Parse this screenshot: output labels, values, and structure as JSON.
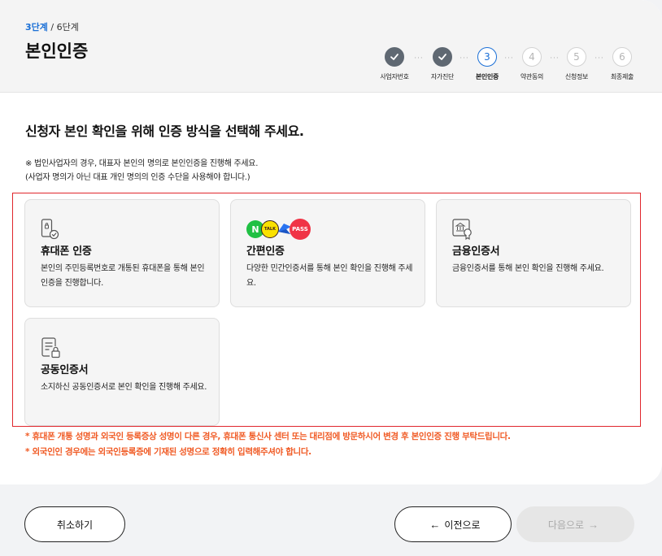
{
  "progress": {
    "current": "3단계",
    "separator": " / ",
    "total": "6단계"
  },
  "page_title": "본인인증",
  "steps": [
    {
      "label": "사업자번호",
      "state": "done"
    },
    {
      "label": "자가진단",
      "state": "done"
    },
    {
      "number": "3",
      "label": "본인인증",
      "state": "active"
    },
    {
      "number": "4",
      "label": "약관동의",
      "state": "todo"
    },
    {
      "number": "5",
      "label": "신청정보",
      "state": "todo"
    },
    {
      "number": "6",
      "label": "최종제출",
      "state": "todo"
    }
  ],
  "step_separator": "···",
  "heading": "신청자 본인 확인을 위해 인증 방식을 선택해 주세요.",
  "notes": {
    "line1": "※ 법인사업자의 경우, 대표자 본인의 명의로 본인인증을 진행해 주세요.",
    "line2": "(사업자 명의가 아닌 대표 개인 명의의 인증 수단을 사용해야 합니다.)"
  },
  "options": {
    "phone": {
      "title": "휴대폰 인증",
      "desc": "본인의 주민등록번호로 개통된 휴대폰을 통해 본인 인증을 진행합니다.",
      "icon": "phone-check-icon"
    },
    "simple": {
      "title": "간편인증",
      "desc": "다양한 민간인증서를 통해 본인 확인을 진행해 주세요.",
      "logos": {
        "naver": "N",
        "kakao": "TALK",
        "pass": "PASS"
      }
    },
    "financial": {
      "title": "금융인증서",
      "desc": "금융인증서를 통해 본인 확인을 진행해 주세요.",
      "icon": "bank-certificate-icon"
    },
    "joint": {
      "title": "공동인증서",
      "desc": "소지하신 공동인증서로 본인 확인을 진행해 주세요.",
      "icon": "document-lock-icon"
    }
  },
  "warnings": {
    "line1": "* 휴대폰 개통 성명과 외국인 등록증상 성명이 다른 경우, 휴대폰 통신사 센터 또는 대리점에 방문하시어 변경 후 본인인증 진행 부탁드립니다.",
    "line2": "* 외국인인 경우에는 외국인등록증에 기재된 성명으로 정확히 입력해주셔야 합니다."
  },
  "buttons": {
    "cancel": "취소하기",
    "prev": "이전으로",
    "next": "다음으로"
  },
  "colors": {
    "accent": "#1a6fd6",
    "warning": "#f05a24",
    "selection_outline": "#e0262c",
    "done_step": "#5f6872"
  }
}
